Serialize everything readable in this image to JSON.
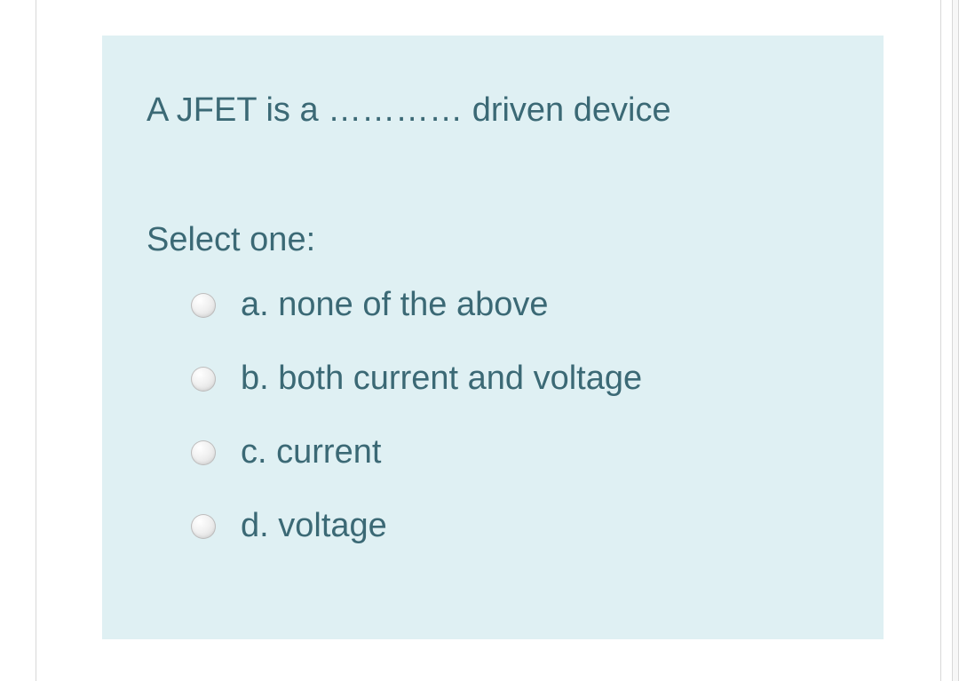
{
  "question": {
    "text": "A JFET is a ………… driven device",
    "select_label": "Select one:",
    "options": [
      {
        "letter": "a.",
        "text": "none of the above"
      },
      {
        "letter": "b.",
        "text": "both current and voltage"
      },
      {
        "letter": "c.",
        "text": "current"
      },
      {
        "letter": "d.",
        "text": "voltage"
      }
    ]
  }
}
